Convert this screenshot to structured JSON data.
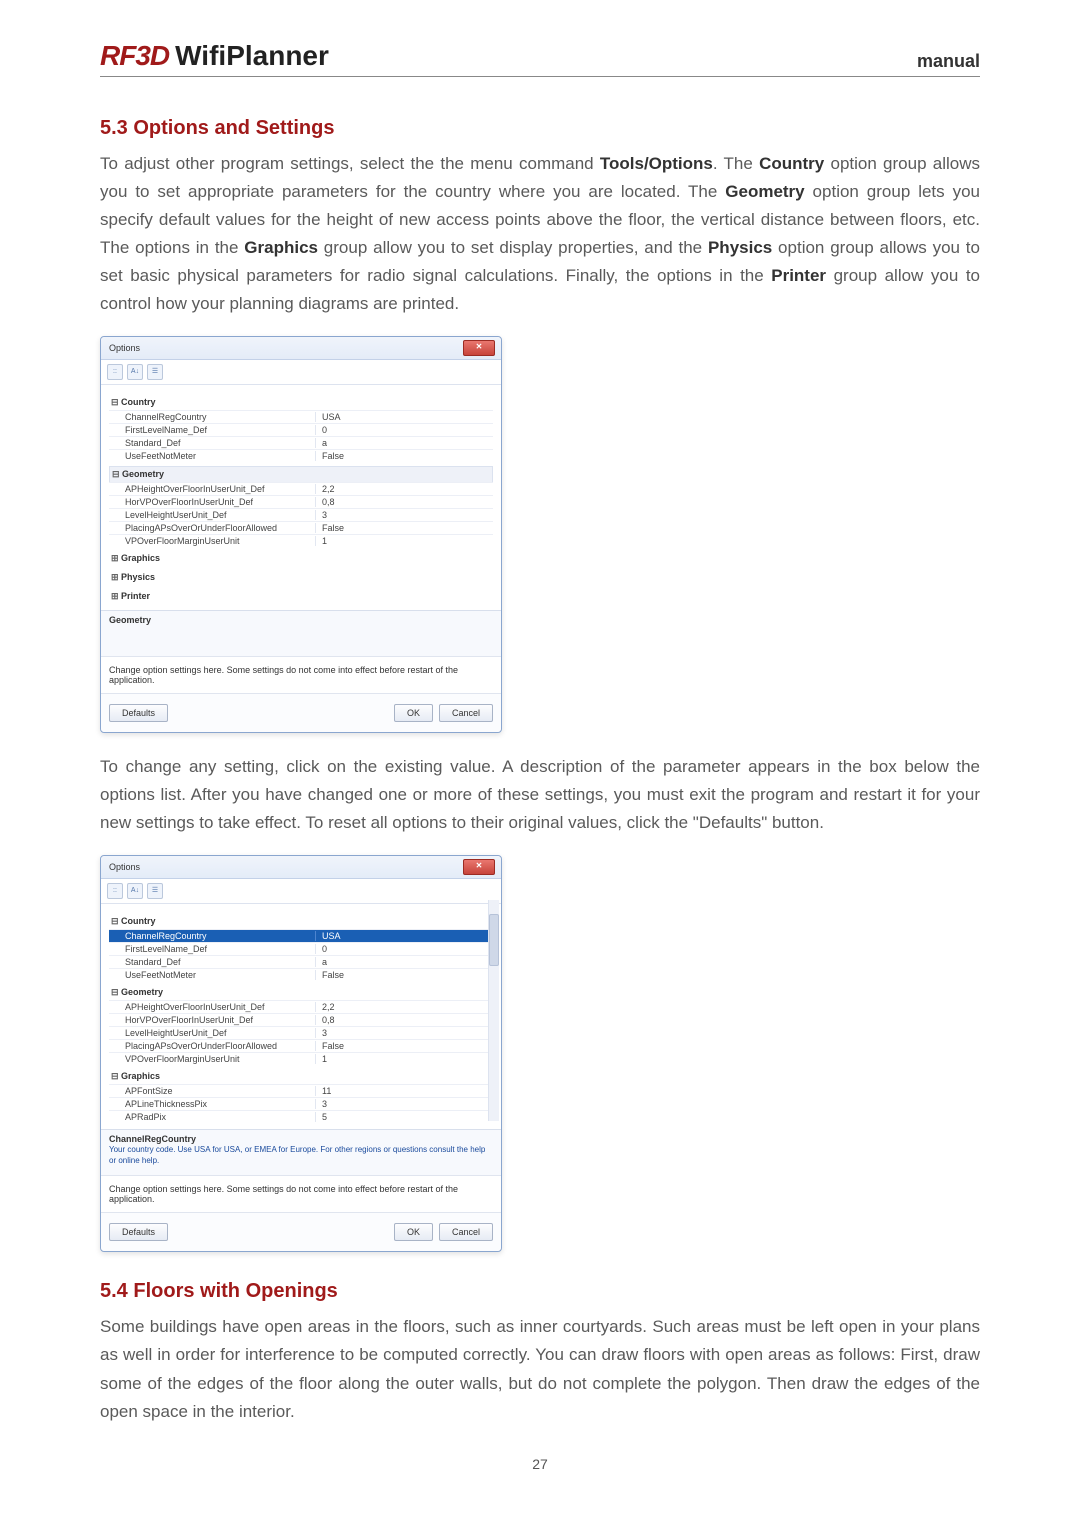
{
  "header": {
    "logo_brand": "RF3D",
    "logo_product": "WifiPlanner",
    "manual_label": "manual"
  },
  "section_53": {
    "title": "5.3 Options and Settings",
    "para1_a": "To adjust other program settings, select the the menu command ",
    "para1_b": "Tools/Options",
    "para1_c": ". The ",
    "para1_d": "Country",
    "para1_e": " option group allows you to set appropriate parameters for the country where you are located. The ",
    "para1_f": "Geometry",
    "para1_g": " option group lets you specify default values for the height of new access points above the floor, the vertical distance between floors, etc. The options in the ",
    "para1_h": "Graphics",
    "para1_i": " group allow you to set display properties, and the ",
    "para1_j": "Physics",
    "para1_k": " option group allows you to set basic physical parameters for radio signal calculations. Finally, the options in the ",
    "para1_l": "Printer",
    "para1_m": " group allow you to control how your planning diagrams are printed.",
    "para2": "To change any setting, click on the existing value. A description of the parameter appears in the box below the options list. After you have changed one or more of these settings, you must exit the program and restart it for your new settings to take effect. To reset all options to their original values, click the \"Defaults\" button."
  },
  "section_54": {
    "title": "5.4 Floors with Openings",
    "para1": "Some buildings have open areas in the floors, such as inner courtyards. Such areas must be left open in your plans as well in order for interference to be computed correctly. You can draw floors with open areas as follows: First, draw some of the edges of the floor along the outer walls, but do not complete the polygon. Then draw the edges of the open space in the interior."
  },
  "dialog1": {
    "title": "Options",
    "groups": {
      "country": {
        "label": "Country",
        "rows": [
          {
            "k": "ChannelRegCountry",
            "v": "USA"
          },
          {
            "k": "FirstLevelName_Def",
            "v": "0"
          },
          {
            "k": "Standard_Def",
            "v": "a"
          },
          {
            "k": "UseFeetNotMeter",
            "v": "False"
          }
        ]
      },
      "geometry": {
        "label": "Geometry",
        "rows": [
          {
            "k": "APHeightOverFloorInUserUnit_Def",
            "v": "2,2"
          },
          {
            "k": "HorVPOverFloorInUserUnit_Def",
            "v": "0,8"
          },
          {
            "k": "LevelHeightUserUnit_Def",
            "v": "3"
          },
          {
            "k": "PlacingAPsOverOrUnderFloorAllowed",
            "v": "False"
          },
          {
            "k": "VPOverFloorMarginUserUnit",
            "v": "1"
          }
        ]
      },
      "graphics": {
        "label": "Graphics"
      },
      "physics": {
        "label": "Physics"
      },
      "printer": {
        "label": "Printer"
      }
    },
    "caption": "Geometry",
    "note": "Change option settings here. Some settings do not come into effect before restart of the application.",
    "defaults_btn": "Defaults",
    "ok_btn": "OK",
    "cancel_btn": "Cancel"
  },
  "dialog2": {
    "title": "Options",
    "groups": {
      "country": {
        "label": "Country",
        "rows": [
          {
            "k": "ChannelRegCountry",
            "v": "USA",
            "selected": true
          },
          {
            "k": "FirstLevelName_Def",
            "v": "0"
          },
          {
            "k": "Standard_Def",
            "v": "a"
          },
          {
            "k": "UseFeetNotMeter",
            "v": "False"
          }
        ]
      },
      "geometry": {
        "label": "Geometry",
        "rows": [
          {
            "k": "APHeightOverFloorInUserUnit_Def",
            "v": "2,2"
          },
          {
            "k": "HorVPOverFloorInUserUnit_Def",
            "v": "0,8"
          },
          {
            "k": "LevelHeightUserUnit_Def",
            "v": "3"
          },
          {
            "k": "PlacingAPsOverOrUnderFloorAllowed",
            "v": "False"
          },
          {
            "k": "VPOverFloorMarginUserUnit",
            "v": "1"
          }
        ]
      },
      "graphics": {
        "label": "Graphics",
        "rows": [
          {
            "k": "APFontSize",
            "v": "11"
          },
          {
            "k": "APLineThicknessPix",
            "v": "3"
          },
          {
            "k": "APRadPix",
            "v": "5"
          }
        ]
      }
    },
    "caption": "ChannelRegCountry",
    "desc": "Your country code. Use USA for USA, or EMEA for Europe. For other regions or questions consult the help or online help.",
    "note": "Change option settings here. Some settings do not come into effect before restart of the application.",
    "defaults_btn": "Defaults",
    "ok_btn": "OK",
    "cancel_btn": "Cancel"
  },
  "page_number": "27"
}
